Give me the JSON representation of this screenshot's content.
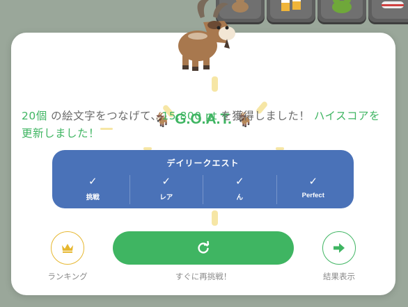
{
  "background_tiles": [
    {
      "icon": "goat-icon"
    },
    {
      "icon": "beer-mugs-icon"
    },
    {
      "icon": "frog-icon"
    },
    {
      "icon": "train-icon"
    }
  ],
  "result": {
    "title": "G.O.A.T.",
    "title_emoji": "🐐",
    "message": {
      "count": "20個",
      "part1": " の絵文字をつなげて、",
      "score": "15,800 pt",
      "part2": " を獲得しました！ ",
      "highscore": "ハイスコアを更新しました！"
    }
  },
  "daily_quest": {
    "title": "デイリークエスト",
    "items": [
      {
        "label": "挑戦",
        "status": "✓"
      },
      {
        "label": "レア",
        "status": "✓"
      },
      {
        "label": "ん",
        "status": "✓"
      },
      {
        "label": "Perfect",
        "status": "✓"
      }
    ]
  },
  "actions": {
    "ranking_label": "ランキング",
    "retry_label": "すぐに再挑戦！",
    "results_label": "結果表示"
  },
  "colors": {
    "accent_green": "#3fb562",
    "quest_blue": "#4a72b8",
    "ranking_gold": "#e6b72f",
    "backdrop": "#9aa79a"
  }
}
